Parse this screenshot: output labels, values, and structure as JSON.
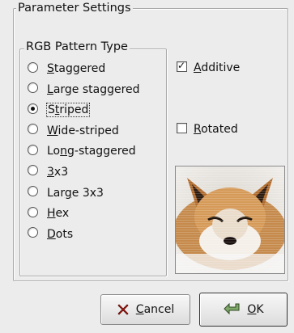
{
  "settings": {
    "group_title": "Parameter Settings",
    "pattern_group_title": "RGB Pattern Type",
    "selected": "Striped",
    "patterns": [
      {
        "pre": "",
        "mn": "S",
        "post": "taggered",
        "checked": false
      },
      {
        "pre": "",
        "mn": "L",
        "post": "arge staggered",
        "checked": false
      },
      {
        "pre": "S",
        "mn": "t",
        "post": "riped",
        "checked": true
      },
      {
        "pre": "",
        "mn": "W",
        "post": "ide-striped",
        "checked": false
      },
      {
        "pre": "Lo",
        "mn": "n",
        "post": "g-staggered",
        "checked": false
      },
      {
        "pre": "",
        "mn": "3",
        "post": "x3",
        "checked": false
      },
      {
        "pre": "Lar",
        "mn": "g",
        "post": "e 3x3",
        "checked": false
      },
      {
        "pre": "",
        "mn": "H",
        "post": "ex",
        "checked": false
      },
      {
        "pre": "",
        "mn": "D",
        "post": "ots",
        "checked": false
      }
    ],
    "additive": {
      "pre": "",
      "mn": "A",
      "post": "dditive",
      "checked": true
    },
    "rotated": {
      "pre": "",
      "mn": "R",
      "post": "otated",
      "checked": false
    },
    "preview_icon": "fox-preview-image"
  },
  "buttons": {
    "cancel": {
      "pre": "",
      "mn": "C",
      "post": "ancel",
      "icon": "cancel-x-icon"
    },
    "ok": {
      "pre": "",
      "mn": "O",
      "post": "K",
      "icon": "ok-arrow-icon"
    }
  }
}
